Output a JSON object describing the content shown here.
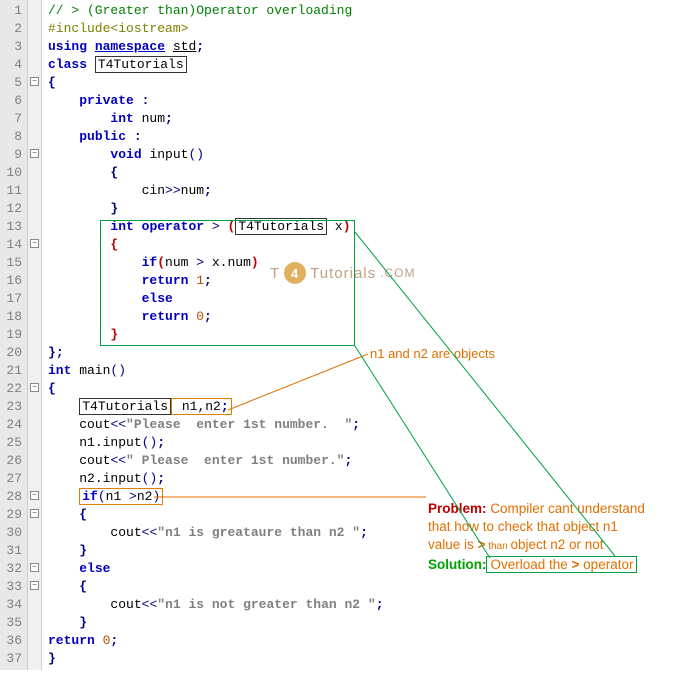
{
  "lines": {
    "1": {
      "comment": "// > (Greater than)Operator overloading"
    },
    "2": {
      "pre": "#include",
      "angle": "<iostream>"
    },
    "3": {
      "kw1": "using",
      "kw2": "namespace",
      "id": "std",
      "sc": ";"
    },
    "4": {
      "kw": "class",
      "id": "T4Tutorials"
    },
    "5": {
      "brace": "{"
    },
    "6": {
      "kw": "private",
      "colon": " :"
    },
    "7": {
      "type": "int",
      "id": " num",
      "sc": ";"
    },
    "8": {
      "kw": "public",
      "colon": " :"
    },
    "9": {
      "type": "void",
      "id": " input",
      "paren": "()"
    },
    "10": {
      "brace": "{"
    },
    "11": {
      "cin": "cin",
      "op": ">>",
      "id": "num",
      "sc": ";"
    },
    "12": {
      "brace": "}"
    },
    "13": {
      "type": "int",
      "kw": "operator",
      "gt": " > ",
      "p1": "(",
      "cls": "T4Tutorials",
      "x": " x",
      "p2": ")"
    },
    "14": {
      "brace": "{"
    },
    "15": {
      "kw": "if",
      "p1": "(",
      "id1": "num",
      "op": " > ",
      "id2": "x.num",
      "p2": ")"
    },
    "16": {
      "kw": "return",
      "num": " 1",
      "sc": ";"
    },
    "17": {
      "kw": "else"
    },
    "18": {
      "kw": "return",
      "num": " 0",
      "sc": ";"
    },
    "19": {
      "brace": "}"
    },
    "20": {
      "brace": "}",
      "sc": ";"
    },
    "21": {
      "type": "int",
      "id": " main",
      "paren": "()"
    },
    "22": {
      "brace": "{"
    },
    "23": {
      "cls": "T4Tutorials",
      "id": " n1,n2",
      "sc": ";"
    },
    "24": {
      "id": "cout",
      "op": "<<",
      "str": "\"Please  enter 1st number.  \"",
      "sc": ";"
    },
    "25": {
      "id": "n1.input",
      "paren": "()",
      "sc": ";"
    },
    "26": {
      "id": "cout",
      "op": "<<",
      "str": "\" Please  enter 1st number.\"",
      "sc": ";"
    },
    "27": {
      "id": "n2.input",
      "paren": "()",
      "sc": ";"
    },
    "28": {
      "kw": "if",
      "p1": "(",
      "id1": "n1 ",
      "op": ">",
      "id2": "n2",
      "p2": ")"
    },
    "29": {
      "brace": "{"
    },
    "30": {
      "id": "cout",
      "op": "<<",
      "str": "\"n1 is greataure than n2 \"",
      "sc": ";"
    },
    "31": {
      "brace": "}"
    },
    "32": {
      "kw": "else"
    },
    "33": {
      "brace": "{"
    },
    "34": {
      "id": "cout",
      "op": "<<",
      "str": "\"n1 is not greater than n2 \"",
      "sc": ";"
    },
    "35": {
      "brace": "}"
    },
    "36": {
      "kw": "return",
      "num": " 0",
      "sc": ";"
    },
    "37": {
      "brace": "}"
    }
  },
  "annotations": {
    "objects": "n1 and n2 are objects",
    "watermark": {
      "t": "T",
      "num": "4",
      "rest": "Tutorials",
      "com": ".COM"
    },
    "problem_label": "Problem: ",
    "problem_text1": "Compiler cant understand",
    "problem_text2": "that how to check that object n1",
    "problem_text3a": "value is ",
    "problem_gt": ">",
    "problem_than": " than ",
    "problem_text3b": " object n2 or not",
    "solution_label": "Solution:",
    "solution_text1": "Overload the ",
    "solution_gt": ">",
    "solution_text2": "  operator"
  },
  "line_numbers": [
    "1",
    "2",
    "3",
    "4",
    "5",
    "6",
    "7",
    "8",
    "9",
    "10",
    "11",
    "12",
    "13",
    "14",
    "15",
    "16",
    "17",
    "18",
    "19",
    "20",
    "21",
    "22",
    "23",
    "24",
    "25",
    "26",
    "27",
    "28",
    "29",
    "30",
    "31",
    "32",
    "33",
    "34",
    "35",
    "36",
    "37"
  ],
  "fold_markers": [
    5,
    9,
    14,
    22,
    28,
    29,
    32,
    33
  ]
}
